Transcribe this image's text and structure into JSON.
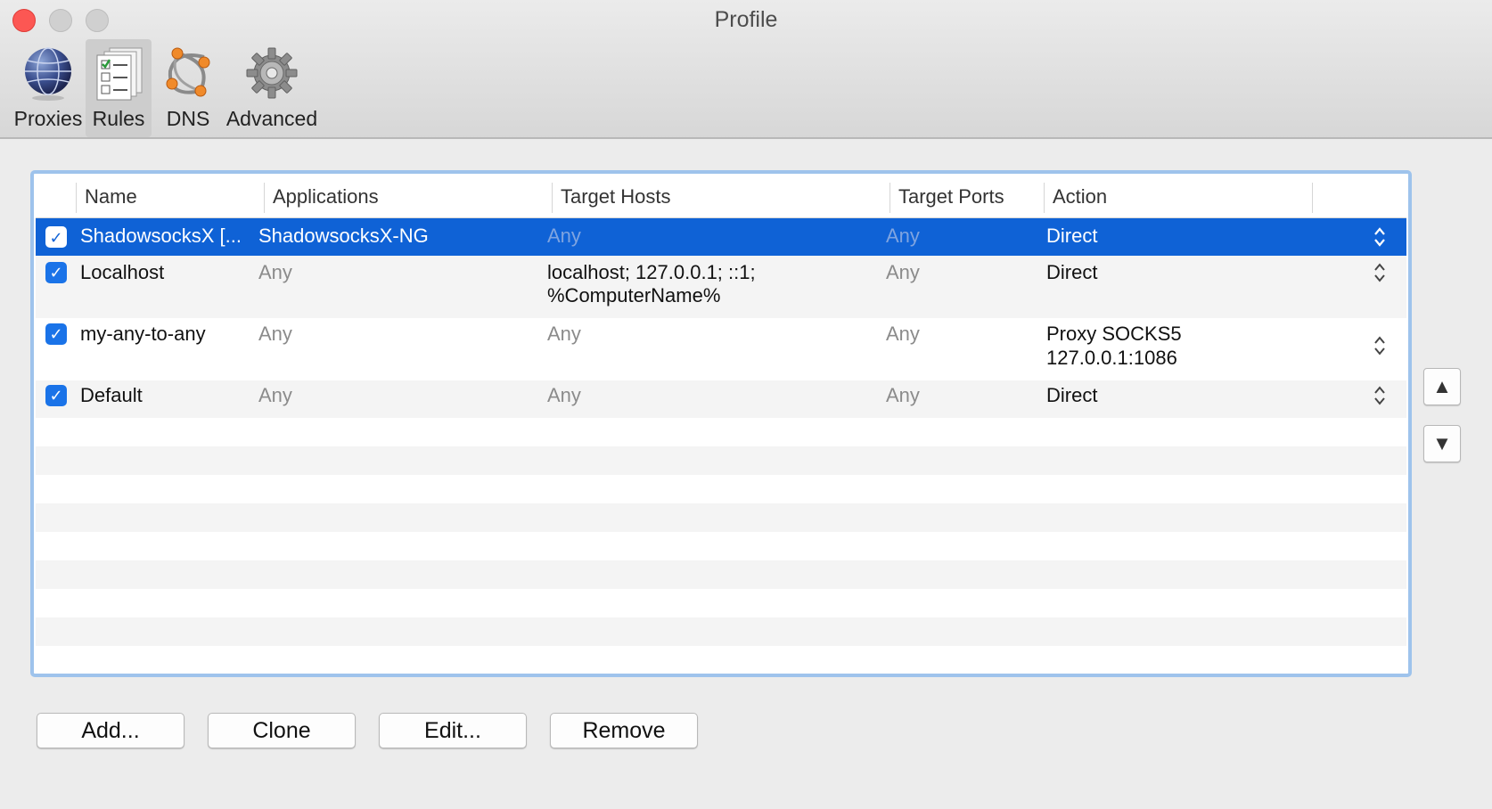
{
  "window": {
    "title": "Profile"
  },
  "toolbar": {
    "items": [
      {
        "label": "Proxies",
        "icon": "globe-icon"
      },
      {
        "label": "Rules",
        "icon": "rules-checklist-icon",
        "selected": true
      },
      {
        "label": "DNS",
        "icon": "dns-network-icon"
      },
      {
        "label": "Advanced",
        "icon": "gear-icon"
      }
    ]
  },
  "table": {
    "columns": [
      "Name",
      "Applications",
      "Target Hosts",
      "Target Ports",
      "Action"
    ],
    "rows": [
      {
        "enabled": true,
        "name": "ShadowsocksX [...",
        "applications": "ShadowsocksX-NG",
        "hosts": [
          "Any"
        ],
        "ports": "Any",
        "action": [
          "Direct"
        ],
        "selected": true
      },
      {
        "enabled": true,
        "name": "Localhost",
        "applications": "Any",
        "hosts": [
          "localhost; 127.0.0.1; ::1;",
          "%ComputerName%"
        ],
        "ports": "Any",
        "action": [
          "Direct"
        ]
      },
      {
        "enabled": true,
        "name": "my-any-to-any",
        "applications": "Any",
        "hosts": [
          "Any"
        ],
        "ports": "Any",
        "action": [
          "Proxy SOCKS5",
          "127.0.0.1:1086"
        ]
      },
      {
        "enabled": true,
        "name": "Default",
        "applications": "Any",
        "hosts": [
          "Any"
        ],
        "ports": "Any",
        "action": [
          "Direct"
        ]
      }
    ]
  },
  "side_buttons": {
    "up": "▲",
    "down": "▼"
  },
  "buttons": {
    "add": "Add...",
    "clone": "Clone",
    "edit": "Edit...",
    "remove": "Remove"
  },
  "colors": {
    "selection": "#0f62d6",
    "focus_ring": "#9ec3ec",
    "checkbox": "#1a73e8",
    "close": "#fc5753"
  }
}
